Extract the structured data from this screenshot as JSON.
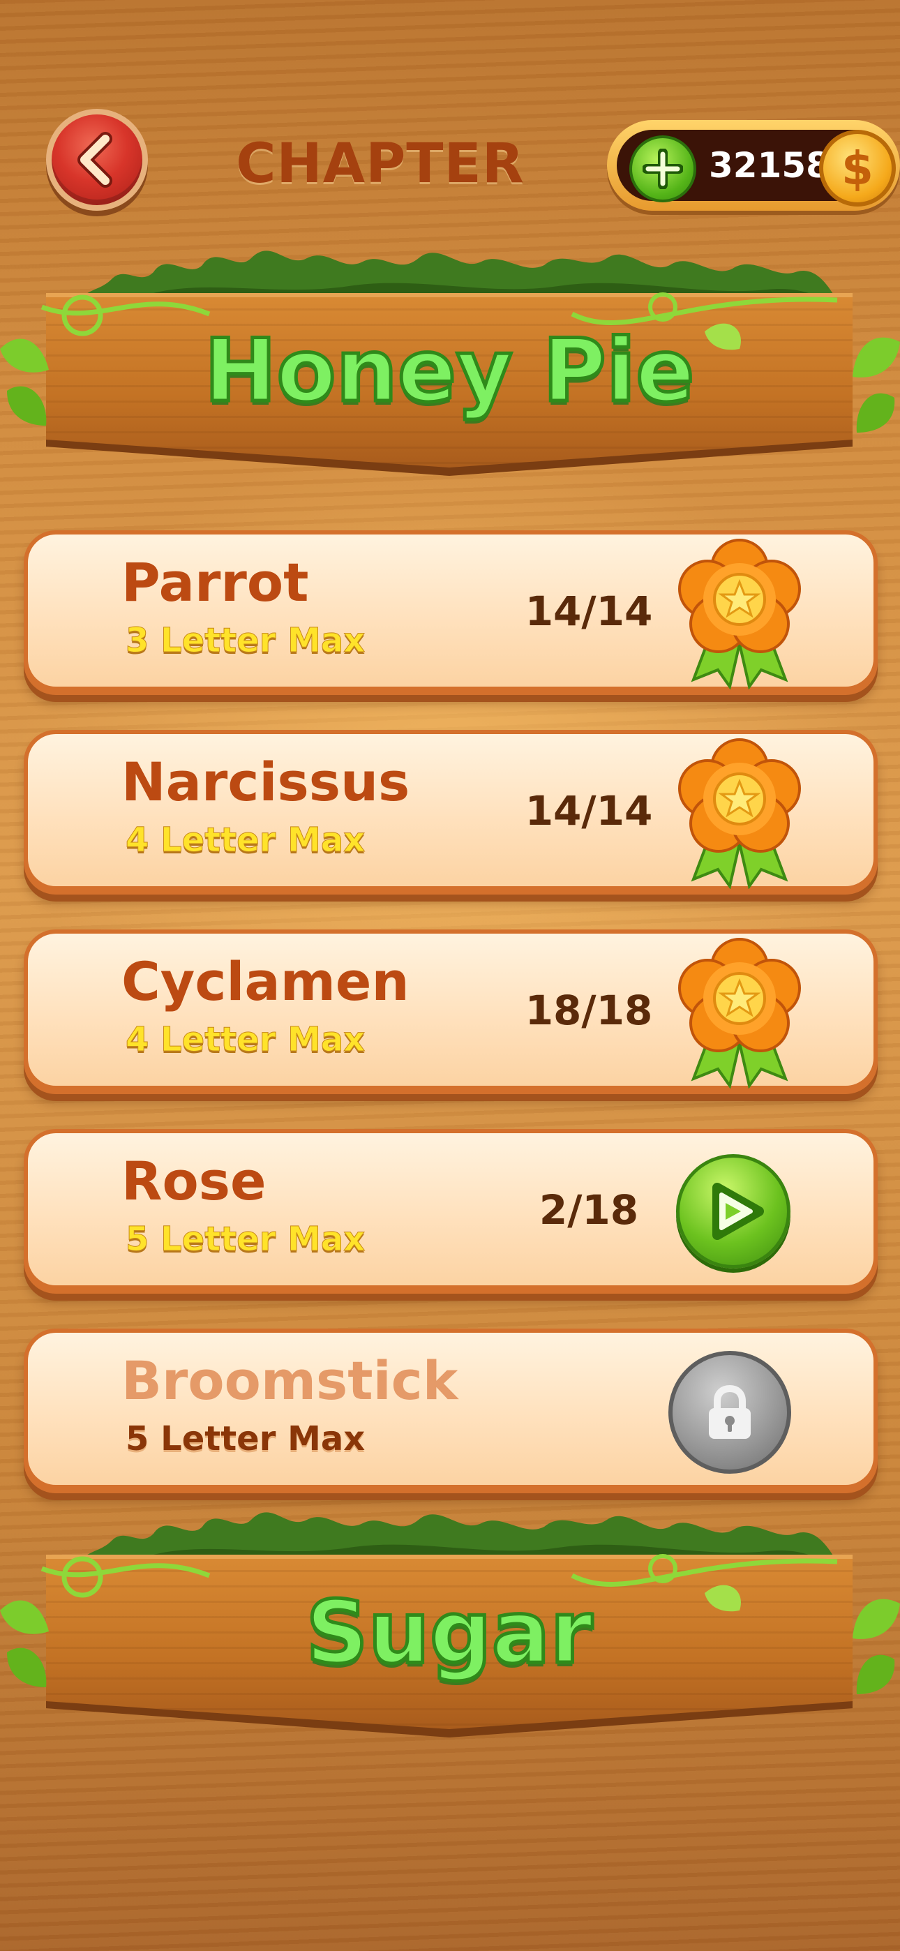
{
  "header": {
    "back_icon": "chevron-left-icon",
    "title": "CHAPTER",
    "coins": "32158",
    "add_coins_icon": "plus-icon",
    "coin_symbol": "$"
  },
  "chapters": [
    {
      "name": "Honey Pie"
    },
    {
      "name": "Sugar"
    }
  ],
  "levels": [
    {
      "name": "Parrot",
      "subtitle": "3 Letter Max",
      "progress": "14/14",
      "status": "completed",
      "icon": "medal-flower-icon"
    },
    {
      "name": "Narcissus",
      "subtitle": "4 Letter Max",
      "progress": "14/14",
      "status": "completed",
      "icon": "medal-flower-icon"
    },
    {
      "name": "Cyclamen",
      "subtitle": "4 Letter Max",
      "progress": "18/18",
      "status": "completed",
      "icon": "medal-flower-icon"
    },
    {
      "name": "Rose",
      "subtitle": "5 Letter Max",
      "progress": "2/18",
      "status": "in-progress",
      "icon": "play-icon"
    },
    {
      "name": "Broomstick",
      "subtitle": "5 Letter Max",
      "progress": "",
      "status": "locked",
      "icon": "lock-icon"
    }
  ],
  "colors": {
    "sign_text": "#7ef062",
    "level_name": "#bc4a12",
    "level_subtitle": "#ffe32a",
    "progress_text": "#5a2a0a"
  }
}
